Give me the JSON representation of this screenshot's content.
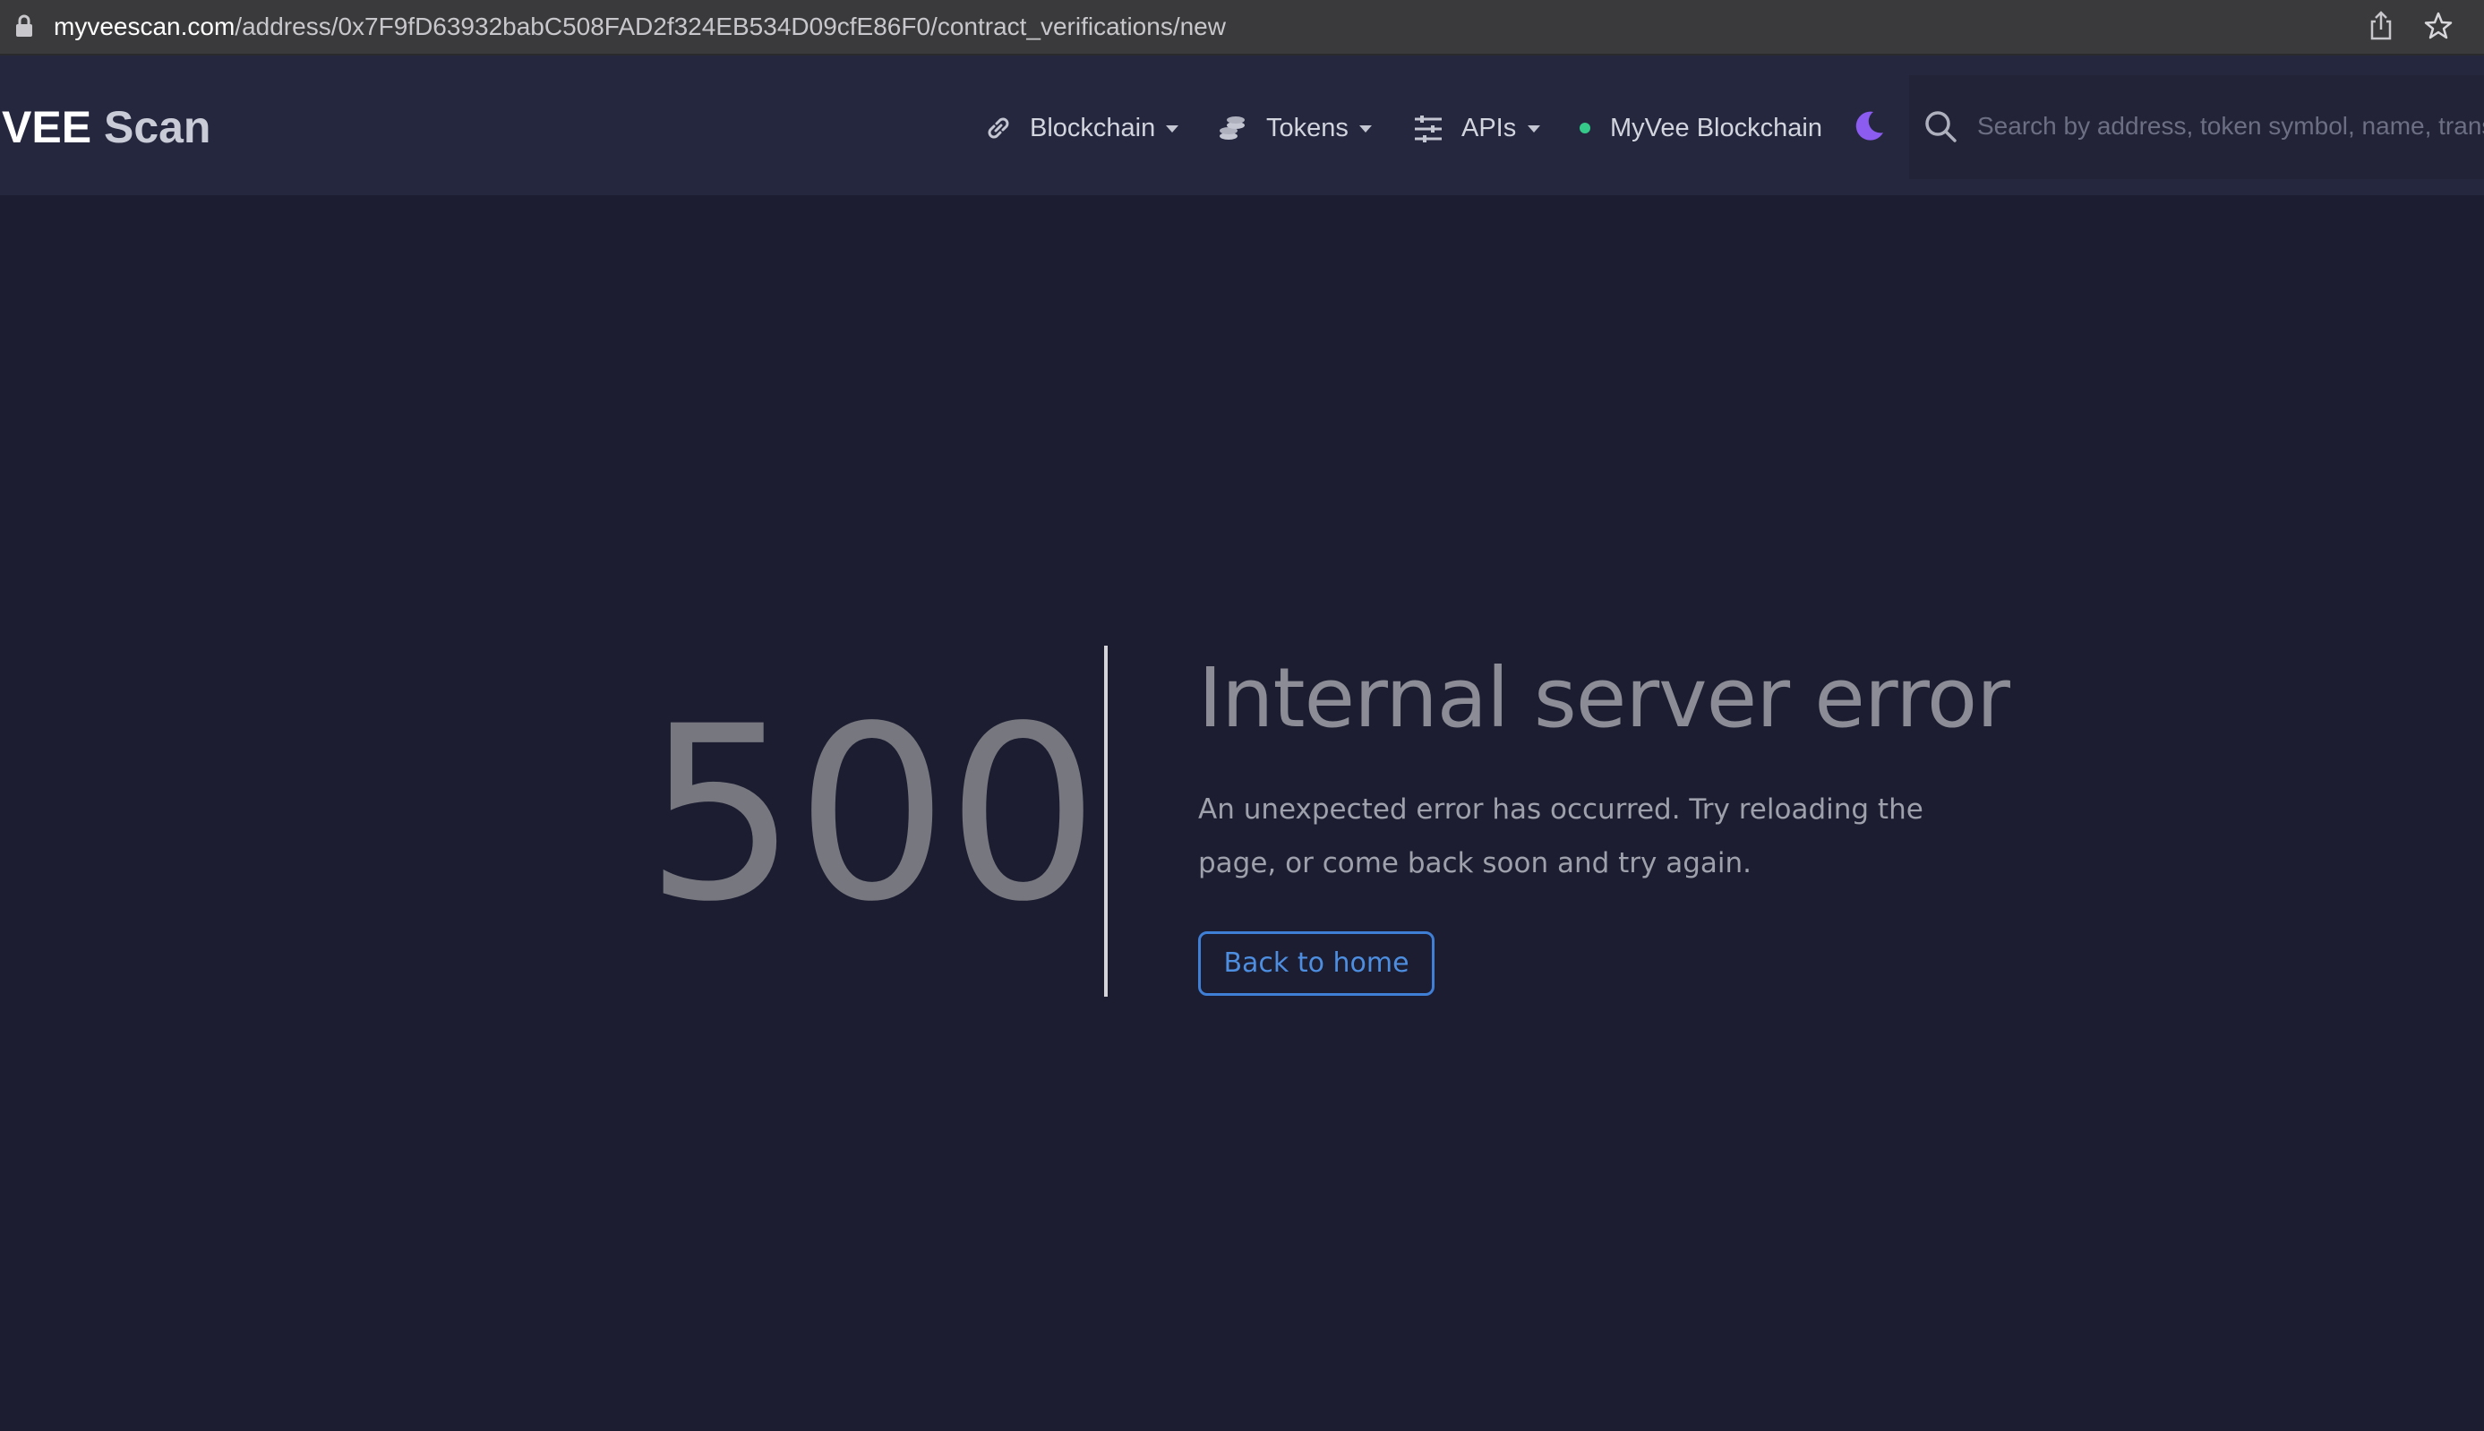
{
  "browser": {
    "url_host": "myveescan.com",
    "url_path": "/address/0x7F9fD63932babC508FAD2f324EB534D09cfE86F0/contract_verifications/new",
    "icons": [
      "lock-icon",
      "share-icon",
      "star-icon"
    ]
  },
  "navbar": {
    "brand_primary": "VEE",
    "brand_secondary": "Scan",
    "items": [
      {
        "label": "Blockchain",
        "icon": "link-icon",
        "has_dropdown": true
      },
      {
        "label": "Tokens",
        "icon": "coins-icon",
        "has_dropdown": true
      },
      {
        "label": "APIs",
        "icon": "sliders-icon",
        "has_dropdown": true
      },
      {
        "label": "MyVee Blockchain",
        "icon": "status-dot",
        "has_dropdown": false
      }
    ],
    "theme_toggle_icon": "moon-icon",
    "search_placeholder": "Search by address, token symbol, name, transaction hash, or block number"
  },
  "error": {
    "code": "500",
    "title": "Internal server error",
    "message": "An unexpected error has occurred. Try reloading the page, or come back soon and try again.",
    "button_label": "Back to home"
  },
  "colors": {
    "page_background": "#1c1d30",
    "navbar_background": "#25273f",
    "accent_blue": "#3f7fd6",
    "status_green": "#35c98a",
    "moon_purple": "#8c5cf0"
  }
}
